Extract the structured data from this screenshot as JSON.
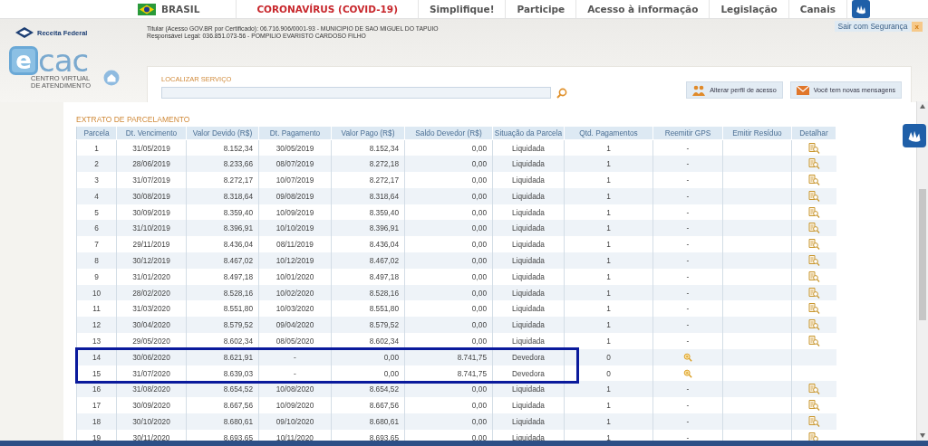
{
  "top_nav": {
    "items": [
      {
        "kind": "country",
        "label": "BRASIL"
      },
      {
        "kind": "alert",
        "label": "CORONAVÍRUS (COVID-19)"
      },
      {
        "kind": "link",
        "label": "Simplifique!"
      },
      {
        "kind": "link",
        "label": "Participe"
      },
      {
        "kind": "link",
        "label": "Acesso à informação"
      },
      {
        "kind": "link",
        "label": "Legislação"
      },
      {
        "kind": "link",
        "label": "Canais"
      }
    ]
  },
  "header": {
    "agency": "Receita Federal",
    "logo": {
      "letter": "e",
      "word": "cac",
      "line1": "CENTRO VIRTUAL",
      "line2": "DE ATENDIMENTO"
    },
    "holder": "Titular (Acesso GOV.BR por Certificado): 06.716.906/0001-93 - MUNICIPIO DE SAO MIGUEL DO TAPUIO",
    "responsible": "Responsável Legal: 036.851.073-56 - POMPILIO EVARISTO CARDOSO FILHO",
    "logout": "Sair com Segurança",
    "logout_close": "x"
  },
  "search": {
    "label": "LOCALIZAR SERVIÇO"
  },
  "actions": [
    {
      "kind": "profile",
      "label": "Alterar perfil de acesso"
    },
    {
      "kind": "messages",
      "label": "Você tem novas mensagens"
    }
  ],
  "table": {
    "title": "EXTRATO DE PARCELAMENTO",
    "columns": [
      "Parcela",
      "Dt. Vencimento",
      "Valor Devido (R$)",
      "Dt. Pagamento",
      "Valor Pago (R$)",
      "Saldo Devedor (R$)",
      "Situação da Parcela",
      "Qtd. Pagamentos",
      "Reemitir GPS",
      "Emitir Resíduo",
      "Detalhar"
    ],
    "rows": [
      {
        "parcela": "1",
        "vencimento": "31/05/2019",
        "valor_devido": "8.152,34",
        "pagamento": "30/05/2019",
        "valor_pago": "8.152,34",
        "saldo": "0,00",
        "situacao": "Liquidada",
        "qtd": "1",
        "gps_available": false,
        "reemitir": "-",
        "detalhar": true,
        "highlighted": false
      },
      {
        "parcela": "2",
        "vencimento": "28/06/2019",
        "valor_devido": "8.233,66",
        "pagamento": "08/07/2019",
        "valor_pago": "8.272,18",
        "saldo": "0,00",
        "situacao": "Liquidada",
        "qtd": "1",
        "gps_available": false,
        "reemitir": "-",
        "detalhar": true,
        "highlighted": false
      },
      {
        "parcela": "3",
        "vencimento": "31/07/2019",
        "valor_devido": "8.272,17",
        "pagamento": "10/07/2019",
        "valor_pago": "8.272,17",
        "saldo": "0,00",
        "situacao": "Liquidada",
        "qtd": "1",
        "gps_available": false,
        "reemitir": "-",
        "detalhar": true,
        "highlighted": false
      },
      {
        "parcela": "4",
        "vencimento": "30/08/2019",
        "valor_devido": "8.318,64",
        "pagamento": "09/08/2019",
        "valor_pago": "8.318,64",
        "saldo": "0,00",
        "situacao": "Liquidada",
        "qtd": "1",
        "gps_available": false,
        "reemitir": "-",
        "detalhar": true,
        "highlighted": false
      },
      {
        "parcela": "5",
        "vencimento": "30/09/2019",
        "valor_devido": "8.359,40",
        "pagamento": "10/09/2019",
        "valor_pago": "8.359,40",
        "saldo": "0,00",
        "situacao": "Liquidada",
        "qtd": "1",
        "gps_available": false,
        "reemitir": "-",
        "detalhar": true,
        "highlighted": false
      },
      {
        "parcela": "6",
        "vencimento": "31/10/2019",
        "valor_devido": "8.396,91",
        "pagamento": "10/10/2019",
        "valor_pago": "8.396,91",
        "saldo": "0,00",
        "situacao": "Liquidada",
        "qtd": "1",
        "gps_available": false,
        "reemitir": "-",
        "detalhar": true,
        "highlighted": false
      },
      {
        "parcela": "7",
        "vencimento": "29/11/2019",
        "valor_devido": "8.436,04",
        "pagamento": "08/11/2019",
        "valor_pago": "8.436,04",
        "saldo": "0,00",
        "situacao": "Liquidada",
        "qtd": "1",
        "gps_available": false,
        "reemitir": "-",
        "detalhar": true,
        "highlighted": false
      },
      {
        "parcela": "8",
        "vencimento": "30/12/2019",
        "valor_devido": "8.467,02",
        "pagamento": "10/12/2019",
        "valor_pago": "8.467,02",
        "saldo": "0,00",
        "situacao": "Liquidada",
        "qtd": "1",
        "gps_available": false,
        "reemitir": "-",
        "detalhar": true,
        "highlighted": false
      },
      {
        "parcela": "9",
        "vencimento": "31/01/2020",
        "valor_devido": "8.497,18",
        "pagamento": "10/01/2020",
        "valor_pago": "8.497,18",
        "saldo": "0,00",
        "situacao": "Liquidada",
        "qtd": "1",
        "gps_available": false,
        "reemitir": "-",
        "detalhar": true,
        "highlighted": false
      },
      {
        "parcela": "10",
        "vencimento": "28/02/2020",
        "valor_devido": "8.528,16",
        "pagamento": "10/02/2020",
        "valor_pago": "8.528,16",
        "saldo": "0,00",
        "situacao": "Liquidada",
        "qtd": "1",
        "gps_available": false,
        "reemitir": "-",
        "detalhar": true,
        "highlighted": false
      },
      {
        "parcela": "11",
        "vencimento": "31/03/2020",
        "valor_devido": "8.551,80",
        "pagamento": "10/03/2020",
        "valor_pago": "8.551,80",
        "saldo": "0,00",
        "situacao": "Liquidada",
        "qtd": "1",
        "gps_available": false,
        "reemitir": "-",
        "detalhar": true,
        "highlighted": false
      },
      {
        "parcela": "12",
        "vencimento": "30/04/2020",
        "valor_devido": "8.579,52",
        "pagamento": "09/04/2020",
        "valor_pago": "8.579,52",
        "saldo": "0,00",
        "situacao": "Liquidada",
        "qtd": "1",
        "gps_available": false,
        "reemitir": "-",
        "detalhar": true,
        "highlighted": false
      },
      {
        "parcela": "13",
        "vencimento": "29/05/2020",
        "valor_devido": "8.602,34",
        "pagamento": "08/05/2020",
        "valor_pago": "8.602,34",
        "saldo": "0,00",
        "situacao": "Liquidada",
        "qtd": "1",
        "gps_available": false,
        "reemitir": "-",
        "detalhar": true,
        "highlighted": false
      },
      {
        "parcela": "14",
        "vencimento": "30/06/2020",
        "valor_devido": "8.621,91",
        "pagamento": "-",
        "valor_pago": "0,00",
        "saldo": "8.741,75",
        "situacao": "Devedora",
        "qtd": "0",
        "gps_available": true,
        "detalhar": false,
        "highlighted": true
      },
      {
        "parcela": "15",
        "vencimento": "31/07/2020",
        "valor_devido": "8.639,03",
        "pagamento": "-",
        "valor_pago": "0,00",
        "saldo": "8.741,75",
        "situacao": "Devedora",
        "qtd": "0",
        "gps_available": true,
        "detalhar": false,
        "highlighted": true
      },
      {
        "parcela": "16",
        "vencimento": "31/08/2020",
        "valor_devido": "8.654,52",
        "pagamento": "10/08/2020",
        "valor_pago": "8.654,52",
        "saldo": "0,00",
        "situacao": "Liquidada",
        "qtd": "1",
        "gps_available": false,
        "reemitir": "-",
        "detalhar": true,
        "highlighted": false
      },
      {
        "parcela": "17",
        "vencimento": "30/09/2020",
        "valor_devido": "8.667,56",
        "pagamento": "10/09/2020",
        "valor_pago": "8.667,56",
        "saldo": "0,00",
        "situacao": "Liquidada",
        "qtd": "1",
        "gps_available": false,
        "reemitir": "-",
        "detalhar": true,
        "highlighted": false
      },
      {
        "parcela": "18",
        "vencimento": "30/10/2020",
        "valor_devido": "8.680,61",
        "pagamento": "09/10/2020",
        "valor_pago": "8.680,61",
        "saldo": "0,00",
        "situacao": "Liquidada",
        "qtd": "1",
        "gps_available": false,
        "reemitir": "-",
        "detalhar": true,
        "highlighted": false
      },
      {
        "parcela": "19",
        "vencimento": "30/11/2020",
        "valor_devido": "8.693,65",
        "pagamento": "10/11/2020",
        "valor_pago": "8.693,65",
        "saldo": "0,00",
        "situacao": "Liquidada",
        "qtd": "1",
        "gps_available": false,
        "reemitir": "-",
        "detalhar": true,
        "highlighted": false
      }
    ]
  }
}
